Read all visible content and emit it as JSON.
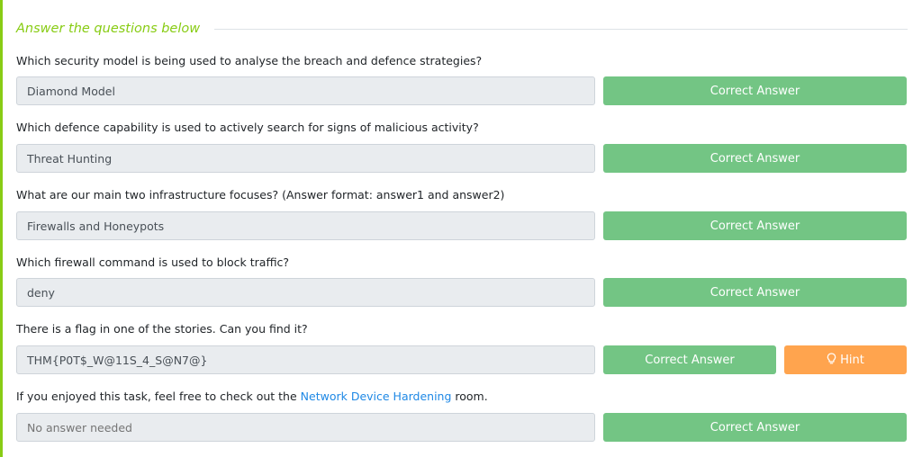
{
  "colors": {
    "accent": "#88cc14",
    "correct_button": "#73c584",
    "hint_button": "#ffa44e",
    "link": "#1e88e5"
  },
  "section": {
    "title": "Answer the questions below"
  },
  "questions": [
    {
      "text": "Which security model is being used to analyse the breach and defence strategies?",
      "answer": "Diamond Model",
      "button": "Correct Answer"
    },
    {
      "text": "Which defence capability is used to actively search for signs of malicious activity?",
      "answer": "Threat Hunting",
      "button": "Correct Answer"
    },
    {
      "text": "What are our main two infrastructure focuses? (Answer format: answer1 and answer2)",
      "answer": "Firewalls and Honeypots",
      "button": "Correct Answer"
    },
    {
      "text": "Which firewall command is used to block traffic?",
      "answer": "deny",
      "button": "Correct Answer"
    },
    {
      "text": "There is a flag in one of the stories. Can you find it?",
      "answer": "THM{P0T$_W@11S_4_S@N7@}",
      "button": "Correct Answer",
      "hint": "Hint",
      "hint_icon": "lightbulb-icon"
    },
    {
      "text_before": "If you enjoyed this task, feel free to check out the ",
      "link": "Network Device Hardening",
      "text_after": " room.",
      "answer": "No answer needed",
      "button": "Correct Answer"
    }
  ]
}
